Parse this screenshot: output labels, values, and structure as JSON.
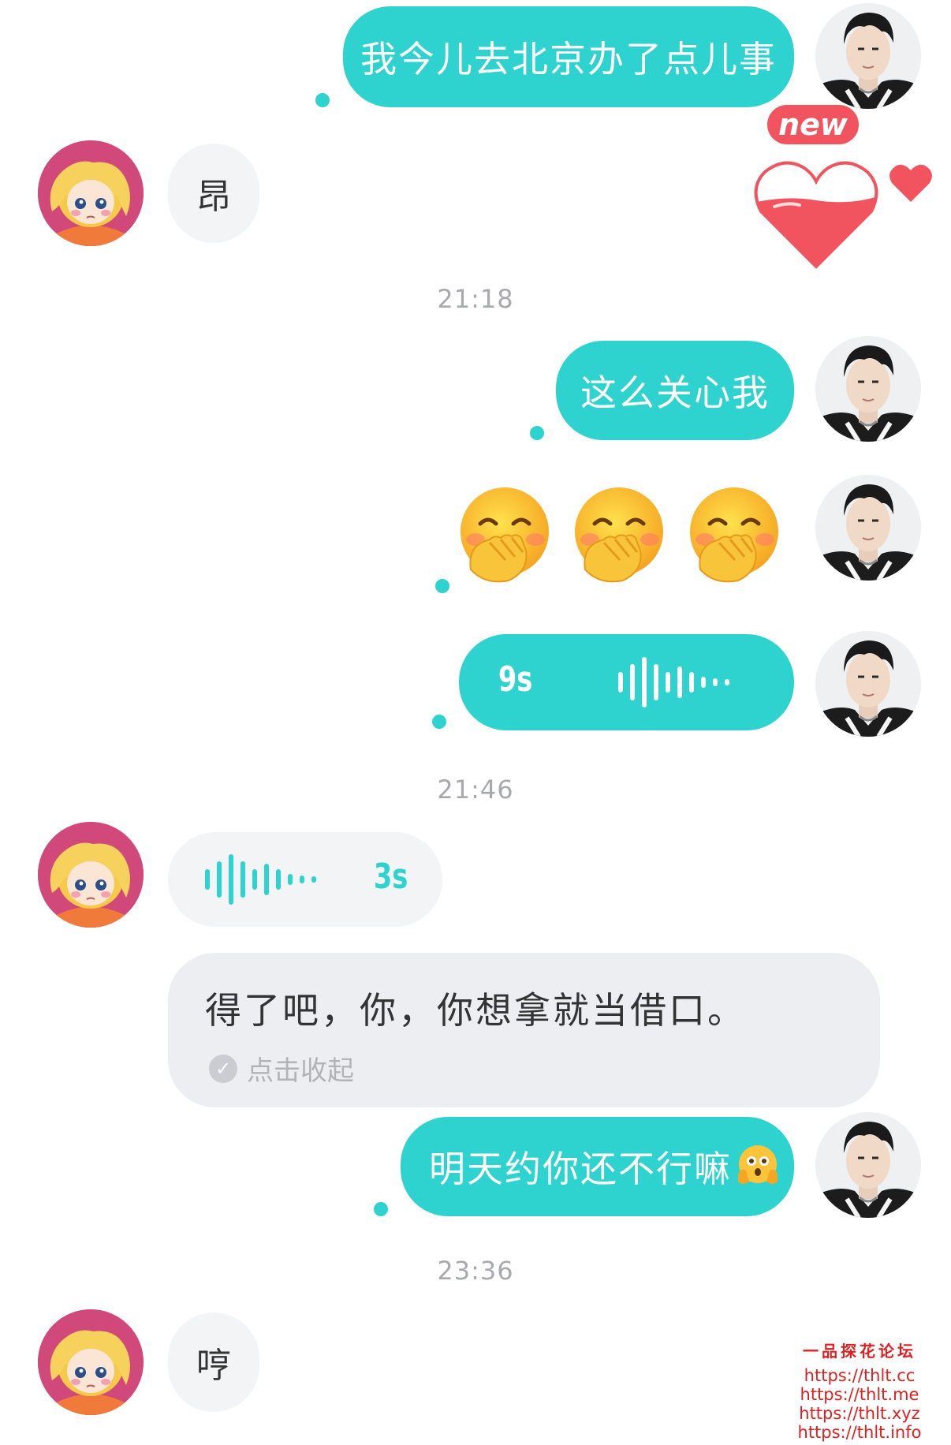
{
  "messages": {
    "m1": "我今儿去北京办了点儿事",
    "m2": "昂",
    "m3": "这么关心我",
    "m4_voice_duration": "9s",
    "m5_voice_duration": "3s",
    "m6": "得了吧，你，你想拿就当借口。",
    "m6_collapse": "点击收起",
    "m7": "明天约你还不行嘛",
    "m8": "哼"
  },
  "timestamps": {
    "t1": "21:18",
    "t2": "21:46",
    "t3": "23:36"
  },
  "badges": {
    "new": "new"
  },
  "watermark": {
    "title": "一品探花论坛",
    "urls": [
      "https://thlt.cc",
      "https://thlt.me",
      "https://thlt.xyz",
      "https://thlt.info"
    ]
  },
  "colors": {
    "accent": "#2ed3cf",
    "incoming_bubble": "#f3f4f6",
    "heart": "#f1545e",
    "watermark": "#e02020"
  },
  "icons": {
    "emoji_repeat": "hand-over-mouth-emoji",
    "emoji_inline": "flushed-hands-emoji"
  }
}
